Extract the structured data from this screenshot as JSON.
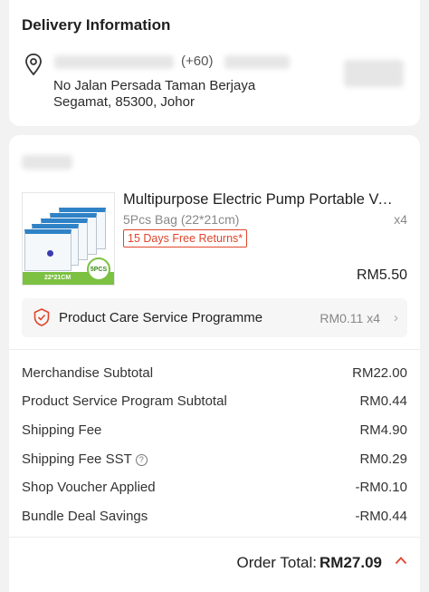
{
  "delivery": {
    "heading": "Delivery Information",
    "phone": "(+60)",
    "address_line1": "No      Jalan Persada Taman Berjaya",
    "address_line2": "Segamat, 85300, Johor"
  },
  "product": {
    "title": "Multipurpose Electric Pump Portable Vacuum Compression Bag",
    "variant": "5Pcs Bag (22*21cm)",
    "quantity": "x4",
    "returns_tag": "15 Days Free Returns*",
    "price": "RM5.50",
    "thumbnail": {
      "size_label": "22*21CM",
      "badge": "5PCS"
    }
  },
  "care_service": {
    "label": "Product Care Service Programme",
    "price": "RM0.11 x4"
  },
  "summary": [
    {
      "label": "Merchandise Subtotal",
      "value": "RM22.00"
    },
    {
      "label": "Product Service Program Subtotal",
      "value": "RM0.44"
    },
    {
      "label": "Shipping Fee",
      "value": "RM4.90"
    },
    {
      "label": "Shipping Fee SST",
      "value": "RM0.29"
    },
    {
      "label": "Shop Voucher Applied",
      "value": "-RM0.10"
    },
    {
      "label": "Bundle Deal Savings",
      "value": "-RM0.44"
    }
  ],
  "order_total": {
    "label": "Order Total:",
    "value": "RM27.09"
  },
  "icons": {
    "location": "location-pin-icon",
    "care": "shield-check-icon",
    "info": "info-icon",
    "chevron_right": "chevron-right-icon",
    "chevron_up": "chevron-up-icon"
  },
  "colors": {
    "accent": "#e0452b",
    "muted": "#888888"
  }
}
